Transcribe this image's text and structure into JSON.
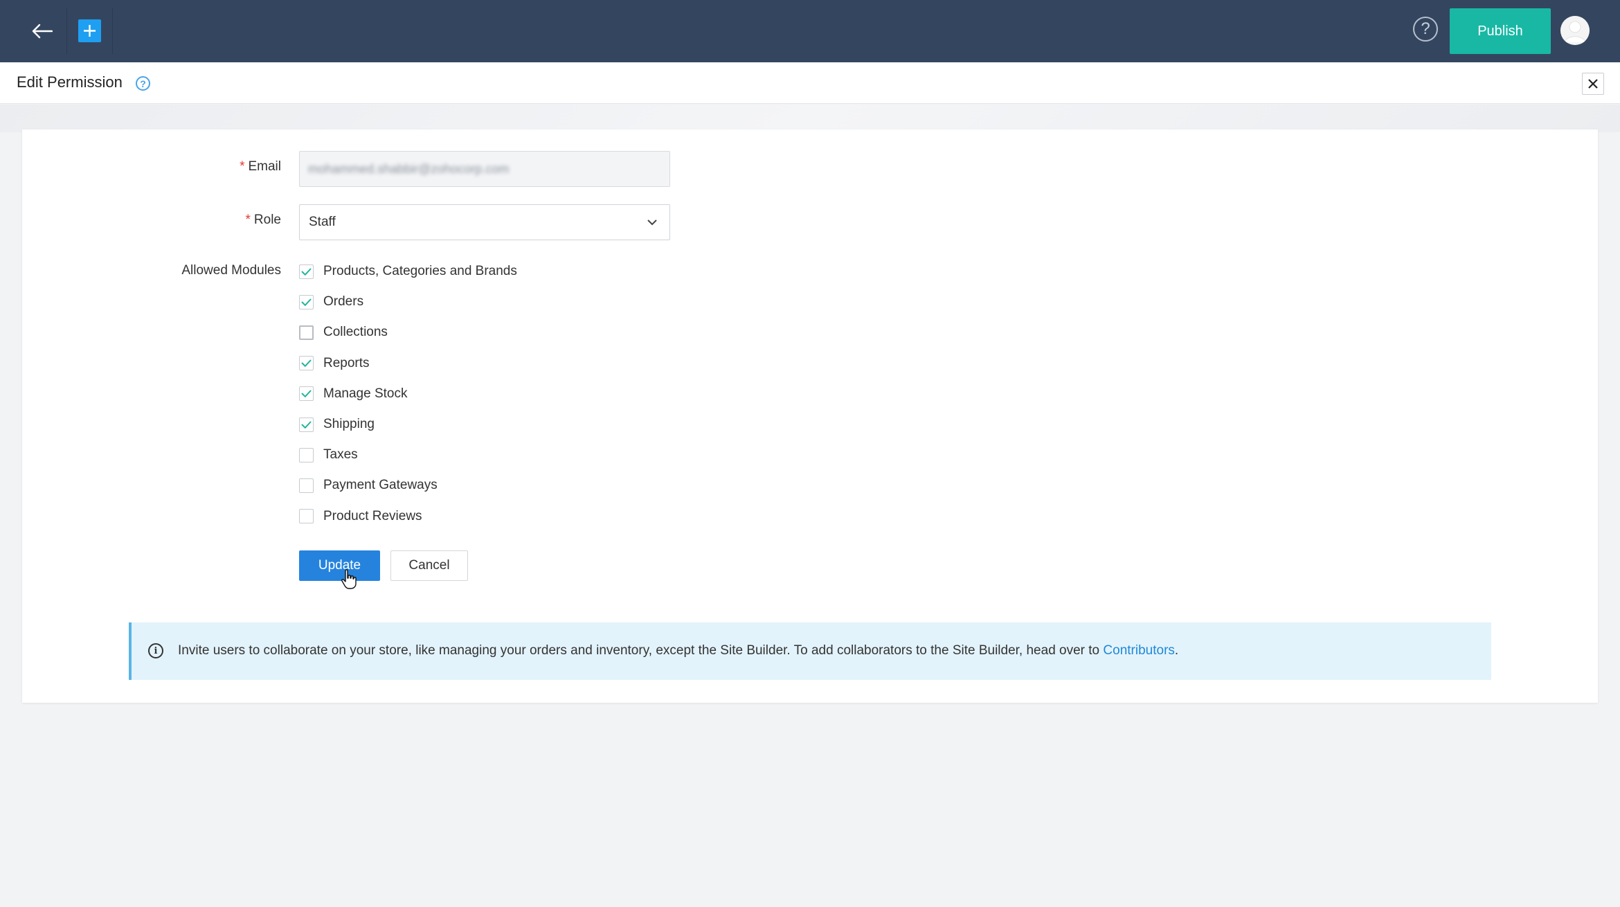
{
  "topbar": {
    "back_icon": "arrow-left-icon",
    "add_icon": "plus-icon",
    "help_glyph": "?",
    "publish_label": "Publish",
    "colors": {
      "bar": "#34465f",
      "publish": "#18b8a4",
      "add": "#1e9ff2"
    }
  },
  "header": {
    "title": "Edit Permission",
    "help_glyph": "?",
    "close_icon": "close-icon"
  },
  "form": {
    "email_label": "Email",
    "email_value": "mohammed.shabbir@zohocorp.com",
    "role_label": "Role",
    "role_value": "Staff",
    "required_mark": "*",
    "modules_label": "Allowed Modules",
    "modules": [
      {
        "label": "Products, Categories and Brands",
        "checked": true
      },
      {
        "label": "Orders",
        "checked": true
      },
      {
        "label": "Collections",
        "checked": false
      },
      {
        "label": "Reports",
        "checked": true
      },
      {
        "label": "Manage Stock",
        "checked": true
      },
      {
        "label": "Shipping",
        "checked": true
      },
      {
        "label": "Taxes",
        "checked": false
      },
      {
        "label": "Payment Gateways",
        "checked": false
      },
      {
        "label": "Product Reviews",
        "checked": false
      }
    ],
    "update_label": "Update",
    "cancel_label": "Cancel"
  },
  "info": {
    "icon_glyph": "i",
    "text": "Invite users to collaborate on your store, like managing your orders and inventory, except the Site Builder. To add collaborators to the Site Builder, head over to ",
    "link_text": "Contributors",
    "suffix": ".",
    "accent": "#5ab4e6"
  }
}
